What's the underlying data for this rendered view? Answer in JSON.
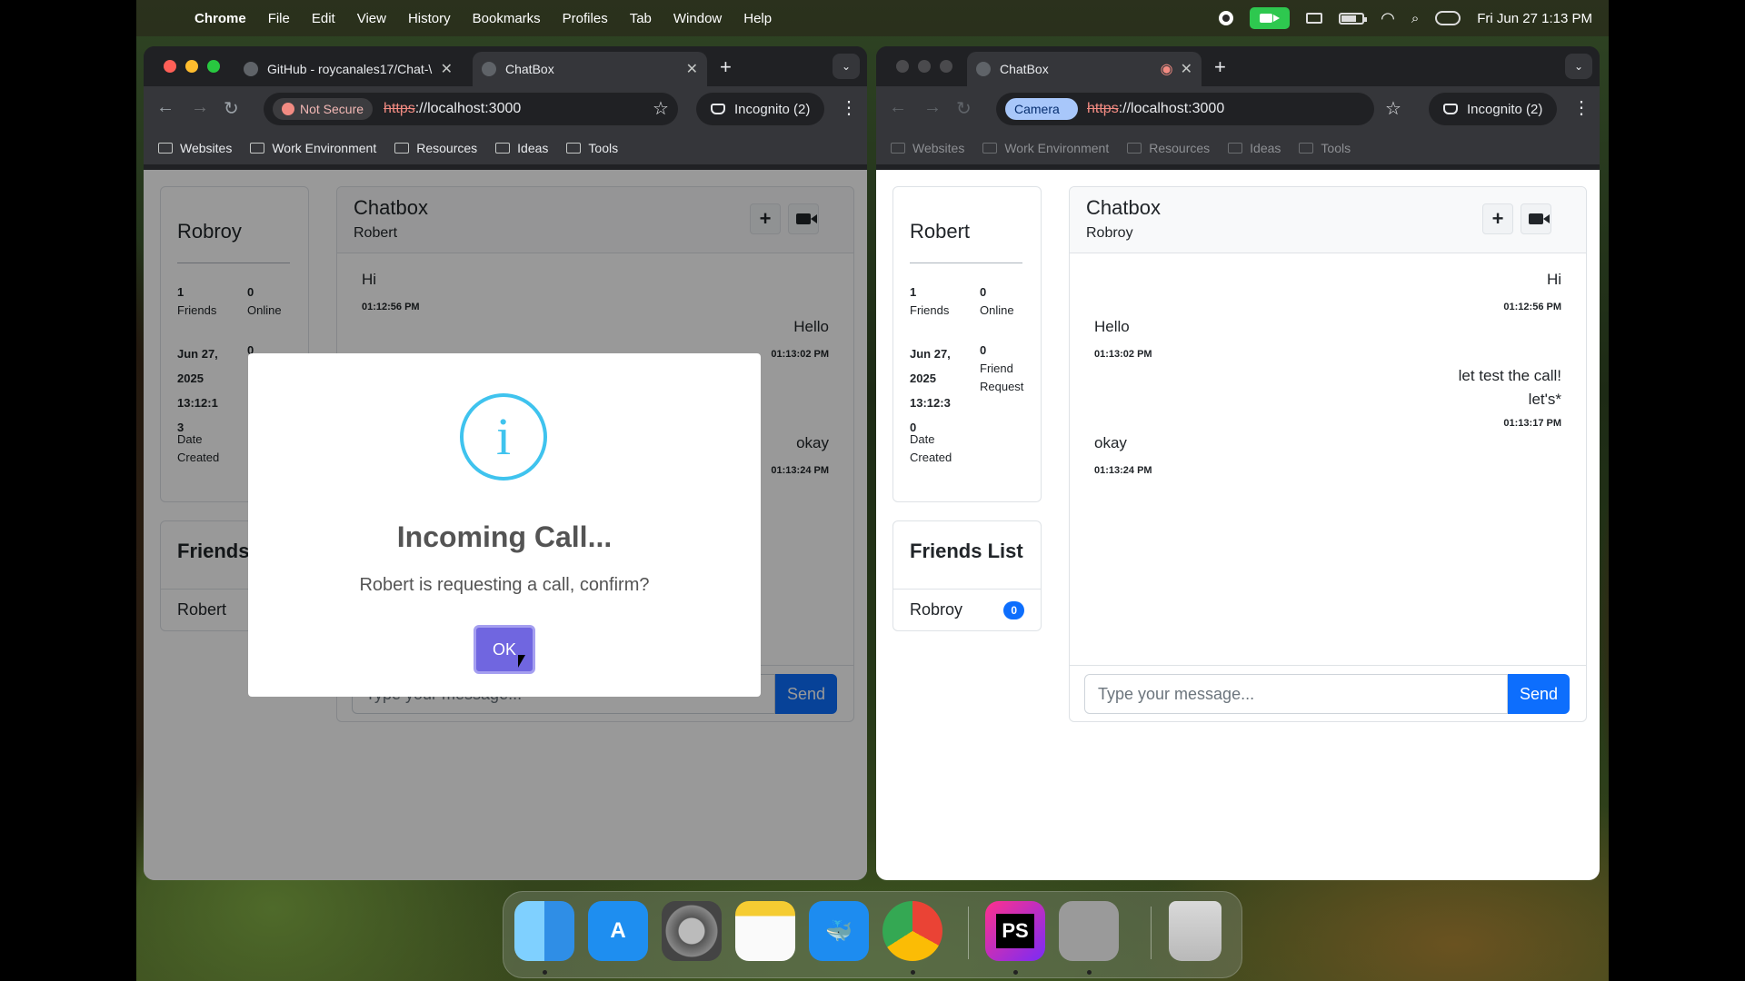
{
  "menubar": {
    "app_name": "Chrome",
    "menus": [
      "File",
      "Edit",
      "View",
      "History",
      "Bookmarks",
      "Profiles",
      "Tab",
      "Window",
      "Help"
    ],
    "clock": "Fri Jun 27  1:13 PM"
  },
  "left_window": {
    "tabs": [
      {
        "label": "GitHub - roycanales17/Chat-\\"
      },
      {
        "label": "ChatBox"
      }
    ],
    "security_label": "Not Secure",
    "url_scheme": "https",
    "url_rest": "://localhost:3000",
    "incognito_label": "Incognito (2)",
    "bookmarks": [
      "Websites",
      "Work Environment",
      "Resources",
      "Ideas",
      "Tools"
    ],
    "profile": {
      "name": "Robroy",
      "friends_count": "1",
      "friends_label": "Friends",
      "online_count": "0",
      "online_label": "Online",
      "date_value_line1": "Jun 27,",
      "date_value_line2": "2025",
      "date_value_line3": "13:12:1",
      "date_value_line4": "3",
      "date_label_line1": "Date",
      "date_label_line2": "Created",
      "requests_count": "0"
    },
    "friends_list": {
      "title": "Friends",
      "items": [
        {
          "name": "Robert"
        }
      ]
    },
    "chat": {
      "title": "Chatbox",
      "subtitle": "Robert",
      "messages": [
        {
          "text": "Hi",
          "time": "01:12:56 PM"
        },
        {
          "text": "Hello",
          "time": "01:13:02 PM"
        },
        {
          "text": "okay",
          "time": "01:13:24 PM"
        }
      ],
      "input_placeholder": "Type your message...",
      "send_label": "Send"
    },
    "modal": {
      "icon": "i",
      "title": "Incoming Call...",
      "text": "Robert is requesting a call, confirm?",
      "ok_label": "OK"
    }
  },
  "right_window": {
    "tabs": [
      {
        "label": "ChatBox"
      }
    ],
    "camera_chip": "Camera",
    "url_scheme": "https",
    "url_rest": "://localhost:3000",
    "incognito_label": "Incognito (2)",
    "bookmarks": [
      "Websites",
      "Work Environment",
      "Resources",
      "Ideas",
      "Tools"
    ],
    "profile": {
      "name": "Robert",
      "friends_count": "1",
      "friends_label": "Friends",
      "online_count": "0",
      "online_label": "Online",
      "date_value_line1": "Jun 27,",
      "date_value_line2": "2025",
      "date_value_line3": "13:12:3",
      "date_value_line4": "0",
      "date_label_line1": "Date",
      "date_label_line2": "Created",
      "requests_count": "0",
      "requests_label_line1": "Friend",
      "requests_label_line2": "Request"
    },
    "friends_list": {
      "title": "Friends List",
      "items": [
        {
          "name": "Robroy",
          "badge": "0"
        }
      ]
    },
    "chat": {
      "title": "Chatbox",
      "subtitle": "Robroy",
      "messages": [
        {
          "text": "Hi",
          "time": "01:12:56 PM"
        },
        {
          "text": "Hello",
          "time": "01:13:02 PM"
        },
        {
          "text_line1": "let test the call!",
          "text_line2": "let's*",
          "time": "01:13:17 PM"
        },
        {
          "text": "okay",
          "time": "01:13:24 PM"
        }
      ],
      "input_placeholder": "Type your message...",
      "send_label": "Send"
    }
  },
  "dock": {
    "apps": [
      "finder-icon",
      "app-store-icon",
      "system-settings-icon",
      "notes-icon",
      "docker-icon",
      "chrome-icon",
      "phpstorm-icon",
      "terminal-icon",
      "trash-icon"
    ],
    "phpstorm_label": "PS"
  }
}
